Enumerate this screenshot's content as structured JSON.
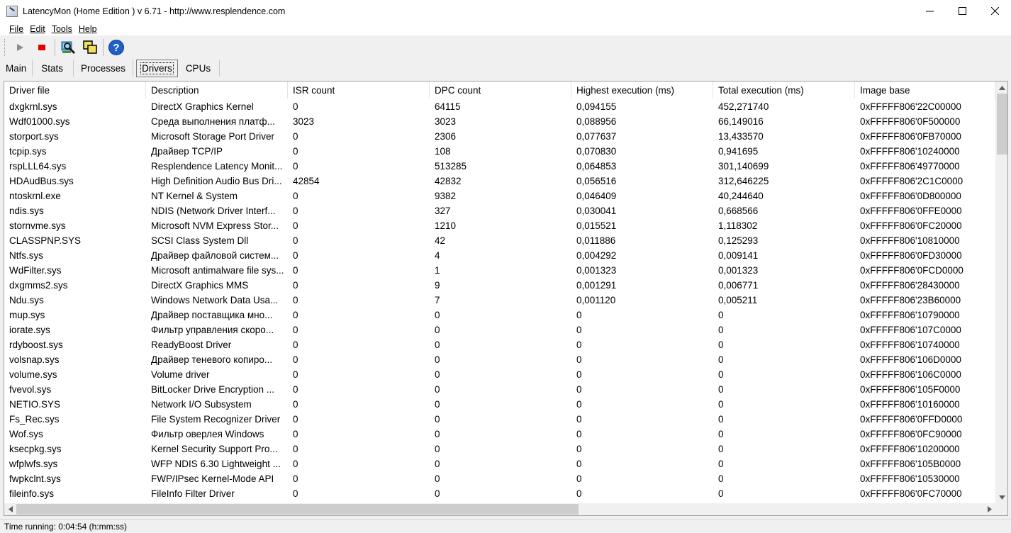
{
  "window": {
    "title": "LatencyMon  (Home Edition )  v 6.71 - http://www.resplendence.com",
    "controls": {
      "minimize": "—",
      "maximize": "☐",
      "close": "✕"
    }
  },
  "menu": [
    {
      "label": "File"
    },
    {
      "label": "Edit"
    },
    {
      "label": "Tools"
    },
    {
      "label": "Help"
    }
  ],
  "toolbar": {
    "buttons": [
      {
        "icon": "play-icon"
      },
      {
        "icon": "stop-icon"
      },
      {
        "icon": "find-drivers-icon"
      },
      {
        "icon": "windows-icon"
      },
      {
        "icon": "help-icon"
      }
    ]
  },
  "tabs": [
    {
      "label": "Main",
      "active": false
    },
    {
      "label": "Stats",
      "active": false
    },
    {
      "label": "Processes",
      "active": false
    },
    {
      "label": "Drivers",
      "active": true
    },
    {
      "label": "CPUs",
      "active": false
    }
  ],
  "table": {
    "columns": [
      "Driver file",
      "Description",
      "ISR count",
      "DPC count",
      "Highest execution (ms)",
      "Total execution (ms)",
      "Image base"
    ],
    "rows": [
      [
        "dxgkrnl.sys",
        "DirectX Graphics Kernel",
        "0",
        "64115",
        "0,094155",
        "452,271740",
        "0xFFFFF806'22C00000"
      ],
      [
        "Wdf01000.sys",
        "Среда выполнения платф...",
        "3023",
        "3023",
        "0,088956",
        "66,149016",
        "0xFFFFF806'0F500000"
      ],
      [
        "storport.sys",
        "Microsoft Storage Port Driver",
        "0",
        "2306",
        "0,077637",
        "13,433570",
        "0xFFFFF806'0FB70000"
      ],
      [
        "tcpip.sys",
        "Драйвер TCP/IP",
        "0",
        "108",
        "0,070830",
        "0,941695",
        "0xFFFFF806'10240000"
      ],
      [
        "rspLLL64.sys",
        "Resplendence Latency Monit...",
        "0",
        "513285",
        "0,064853",
        "301,140699",
        "0xFFFFF806'49770000"
      ],
      [
        "HDAudBus.sys",
        "High Definition Audio Bus Dri...",
        "42854",
        "42832",
        "0,056516",
        "312,646225",
        "0xFFFFF806'2C1C0000"
      ],
      [
        "ntoskrnl.exe",
        "NT Kernel & System",
        "0",
        "9382",
        "0,046409",
        "40,244640",
        "0xFFFFF806'0D800000"
      ],
      [
        "ndis.sys",
        "NDIS (Network Driver Interf...",
        "0",
        "327",
        "0,030041",
        "0,668566",
        "0xFFFFF806'0FFE0000"
      ],
      [
        "stornvme.sys",
        "Microsoft NVM Express Stor...",
        "0",
        "1210",
        "0,015521",
        "1,118302",
        "0xFFFFF806'0FC20000"
      ],
      [
        "CLASSPNP.SYS",
        "SCSI Class System Dll",
        "0",
        "42",
        "0,011886",
        "0,125293",
        "0xFFFFF806'10810000"
      ],
      [
        "Ntfs.sys",
        "Драйвер файловой систем...",
        "0",
        "4",
        "0,004292",
        "0,009141",
        "0xFFFFF806'0FD30000"
      ],
      [
        "WdFilter.sys",
        "Microsoft antimalware file sys...",
        "0",
        "1",
        "0,001323",
        "0,001323",
        "0xFFFFF806'0FCD0000"
      ],
      [
        "dxgmms2.sys",
        "DirectX Graphics MMS",
        "0",
        "9",
        "0,001291",
        "0,006771",
        "0xFFFFF806'28430000"
      ],
      [
        "Ndu.sys",
        "Windows Network Data Usa...",
        "0",
        "7",
        "0,001120",
        "0,005211",
        "0xFFFFF806'23B60000"
      ],
      [
        "mup.sys",
        "Драйвер поставщика мно...",
        "0",
        "0",
        "0",
        "0",
        "0xFFFFF806'10790000"
      ],
      [
        "iorate.sys",
        "Фильтр управления скоро...",
        "0",
        "0",
        "0",
        "0",
        "0xFFFFF806'107C0000"
      ],
      [
        "rdyboost.sys",
        "ReadyBoost Driver",
        "0",
        "0",
        "0",
        "0",
        "0xFFFFF806'10740000"
      ],
      [
        "volsnap.sys",
        "Драйвер теневого копиро...",
        "0",
        "0",
        "0",
        "0",
        "0xFFFFF806'106D0000"
      ],
      [
        "volume.sys",
        "Volume driver",
        "0",
        "0",
        "0",
        "0",
        "0xFFFFF806'106C0000"
      ],
      [
        "fvevol.sys",
        "BitLocker Drive Encryption ...",
        "0",
        "0",
        "0",
        "0",
        "0xFFFFF806'105F0000"
      ],
      [
        "NETIO.SYS",
        "Network I/O Subsystem",
        "0",
        "0",
        "0",
        "0",
        "0xFFFFF806'10160000"
      ],
      [
        "Fs_Rec.sys",
        "File System Recognizer Driver",
        "0",
        "0",
        "0",
        "0",
        "0xFFFFF806'0FFD0000"
      ],
      [
        "Wof.sys",
        "Фильтр оверлея Windows",
        "0",
        "0",
        "0",
        "0",
        "0xFFFFF806'0FC90000"
      ],
      [
        "ksecpkg.sys",
        "Kernel Security Support Pro...",
        "0",
        "0",
        "0",
        "0",
        "0xFFFFF806'10200000"
      ],
      [
        "wfplwfs.sys",
        "WFP NDIS 6.30 Lightweight ...",
        "0",
        "0",
        "0",
        "0",
        "0xFFFFF806'105B0000"
      ],
      [
        "fwpkclnt.sys",
        "FWP/IPsec Kernel-Mode API",
        "0",
        "0",
        "0",
        "0",
        "0xFFFFF806'10530000"
      ],
      [
        "fileinfo.sys",
        "FileInfo Filter Driver",
        "0",
        "0",
        "0",
        "0",
        "0xFFFFF806'0FC70000"
      ]
    ]
  },
  "status": {
    "text": "Time running: 0:04:54  (h:mm:ss)"
  }
}
